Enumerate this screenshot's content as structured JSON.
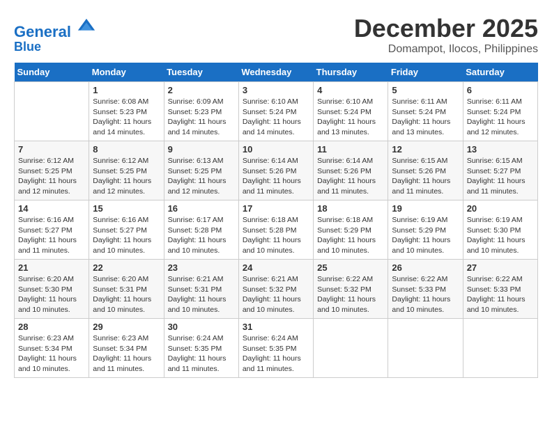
{
  "header": {
    "logo_line1": "General",
    "logo_line2": "Blue",
    "month": "December 2025",
    "location": "Domampot, Ilocos, Philippines"
  },
  "weekdays": [
    "Sunday",
    "Monday",
    "Tuesday",
    "Wednesday",
    "Thursday",
    "Friday",
    "Saturday"
  ],
  "weeks": [
    [
      {
        "day": "",
        "sunrise": "",
        "sunset": "",
        "daylight": ""
      },
      {
        "day": "1",
        "sunrise": "Sunrise: 6:08 AM",
        "sunset": "Sunset: 5:23 PM",
        "daylight": "Daylight: 11 hours and 14 minutes."
      },
      {
        "day": "2",
        "sunrise": "Sunrise: 6:09 AM",
        "sunset": "Sunset: 5:23 PM",
        "daylight": "Daylight: 11 hours and 14 minutes."
      },
      {
        "day": "3",
        "sunrise": "Sunrise: 6:10 AM",
        "sunset": "Sunset: 5:24 PM",
        "daylight": "Daylight: 11 hours and 14 minutes."
      },
      {
        "day": "4",
        "sunrise": "Sunrise: 6:10 AM",
        "sunset": "Sunset: 5:24 PM",
        "daylight": "Daylight: 11 hours and 13 minutes."
      },
      {
        "day": "5",
        "sunrise": "Sunrise: 6:11 AM",
        "sunset": "Sunset: 5:24 PM",
        "daylight": "Daylight: 11 hours and 13 minutes."
      },
      {
        "day": "6",
        "sunrise": "Sunrise: 6:11 AM",
        "sunset": "Sunset: 5:24 PM",
        "daylight": "Daylight: 11 hours and 12 minutes."
      }
    ],
    [
      {
        "day": "7",
        "sunrise": "Sunrise: 6:12 AM",
        "sunset": "Sunset: 5:25 PM",
        "daylight": "Daylight: 11 hours and 12 minutes."
      },
      {
        "day": "8",
        "sunrise": "Sunrise: 6:12 AM",
        "sunset": "Sunset: 5:25 PM",
        "daylight": "Daylight: 11 hours and 12 minutes."
      },
      {
        "day": "9",
        "sunrise": "Sunrise: 6:13 AM",
        "sunset": "Sunset: 5:25 PM",
        "daylight": "Daylight: 11 hours and 12 minutes."
      },
      {
        "day": "10",
        "sunrise": "Sunrise: 6:14 AM",
        "sunset": "Sunset: 5:26 PM",
        "daylight": "Daylight: 11 hours and 11 minutes."
      },
      {
        "day": "11",
        "sunrise": "Sunrise: 6:14 AM",
        "sunset": "Sunset: 5:26 PM",
        "daylight": "Daylight: 11 hours and 11 minutes."
      },
      {
        "day": "12",
        "sunrise": "Sunrise: 6:15 AM",
        "sunset": "Sunset: 5:26 PM",
        "daylight": "Daylight: 11 hours and 11 minutes."
      },
      {
        "day": "13",
        "sunrise": "Sunrise: 6:15 AM",
        "sunset": "Sunset: 5:27 PM",
        "daylight": "Daylight: 11 hours and 11 minutes."
      }
    ],
    [
      {
        "day": "14",
        "sunrise": "Sunrise: 6:16 AM",
        "sunset": "Sunset: 5:27 PM",
        "daylight": "Daylight: 11 hours and 11 minutes."
      },
      {
        "day": "15",
        "sunrise": "Sunrise: 6:16 AM",
        "sunset": "Sunset: 5:27 PM",
        "daylight": "Daylight: 11 hours and 10 minutes."
      },
      {
        "day": "16",
        "sunrise": "Sunrise: 6:17 AM",
        "sunset": "Sunset: 5:28 PM",
        "daylight": "Daylight: 11 hours and 10 minutes."
      },
      {
        "day": "17",
        "sunrise": "Sunrise: 6:18 AM",
        "sunset": "Sunset: 5:28 PM",
        "daylight": "Daylight: 11 hours and 10 minutes."
      },
      {
        "day": "18",
        "sunrise": "Sunrise: 6:18 AM",
        "sunset": "Sunset: 5:29 PM",
        "daylight": "Daylight: 11 hours and 10 minutes."
      },
      {
        "day": "19",
        "sunrise": "Sunrise: 6:19 AM",
        "sunset": "Sunset: 5:29 PM",
        "daylight": "Daylight: 11 hours and 10 minutes."
      },
      {
        "day": "20",
        "sunrise": "Sunrise: 6:19 AM",
        "sunset": "Sunset: 5:30 PM",
        "daylight": "Daylight: 11 hours and 10 minutes."
      }
    ],
    [
      {
        "day": "21",
        "sunrise": "Sunrise: 6:20 AM",
        "sunset": "Sunset: 5:30 PM",
        "daylight": "Daylight: 11 hours and 10 minutes."
      },
      {
        "day": "22",
        "sunrise": "Sunrise: 6:20 AM",
        "sunset": "Sunset: 5:31 PM",
        "daylight": "Daylight: 11 hours and 10 minutes."
      },
      {
        "day": "23",
        "sunrise": "Sunrise: 6:21 AM",
        "sunset": "Sunset: 5:31 PM",
        "daylight": "Daylight: 11 hours and 10 minutes."
      },
      {
        "day": "24",
        "sunrise": "Sunrise: 6:21 AM",
        "sunset": "Sunset: 5:32 PM",
        "daylight": "Daylight: 11 hours and 10 minutes."
      },
      {
        "day": "25",
        "sunrise": "Sunrise: 6:22 AM",
        "sunset": "Sunset: 5:32 PM",
        "daylight": "Daylight: 11 hours and 10 minutes."
      },
      {
        "day": "26",
        "sunrise": "Sunrise: 6:22 AM",
        "sunset": "Sunset: 5:33 PM",
        "daylight": "Daylight: 11 hours and 10 minutes."
      },
      {
        "day": "27",
        "sunrise": "Sunrise: 6:22 AM",
        "sunset": "Sunset: 5:33 PM",
        "daylight": "Daylight: 11 hours and 10 minutes."
      }
    ],
    [
      {
        "day": "28",
        "sunrise": "Sunrise: 6:23 AM",
        "sunset": "Sunset: 5:34 PM",
        "daylight": "Daylight: 11 hours and 10 minutes."
      },
      {
        "day": "29",
        "sunrise": "Sunrise: 6:23 AM",
        "sunset": "Sunset: 5:34 PM",
        "daylight": "Daylight: 11 hours and 11 minutes."
      },
      {
        "day": "30",
        "sunrise": "Sunrise: 6:24 AM",
        "sunset": "Sunset: 5:35 PM",
        "daylight": "Daylight: 11 hours and 11 minutes."
      },
      {
        "day": "31",
        "sunrise": "Sunrise: 6:24 AM",
        "sunset": "Sunset: 5:35 PM",
        "daylight": "Daylight: 11 hours and 11 minutes."
      },
      {
        "day": "",
        "sunrise": "",
        "sunset": "",
        "daylight": ""
      },
      {
        "day": "",
        "sunrise": "",
        "sunset": "",
        "daylight": ""
      },
      {
        "day": "",
        "sunrise": "",
        "sunset": "",
        "daylight": ""
      }
    ]
  ]
}
